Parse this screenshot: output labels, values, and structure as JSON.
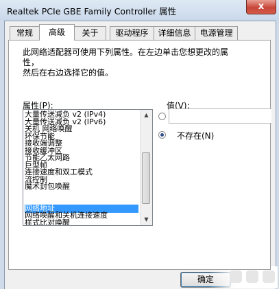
{
  "window": {
    "title": "Realtek PCIe GBE Family Controller 属性",
    "close_label": "x"
  },
  "tabs": [
    {
      "label": "常规",
      "active": false
    },
    {
      "label": "高级",
      "active": true
    },
    {
      "label": "关于",
      "active": false
    },
    {
      "label": "驱动程序",
      "active": false
    },
    {
      "label": "详细信息",
      "active": false
    },
    {
      "label": "电源管理",
      "active": false
    }
  ],
  "advanced": {
    "description_line1": "此网络适配器可使用下列属性。在左边单击您想更改的属性，",
    "description_line2": "然后在右边选择它的值。",
    "property_label": "属性(P):",
    "value_label": "值(V):",
    "value_input": "",
    "not_present_label": "不存在(N)",
    "selected_index": 13,
    "properties": [
      "大量传送减负 v2 (IPv4)",
      "大量传送减负 v2 (IPv6)",
      "关机 网络唤醒",
      "环保节能",
      "接收端调整",
      "接收缓冲区",
      "节能乙太网路",
      "巨型帧",
      "连接速度和双工模式",
      "流控制",
      "魔术封包唤醒",
      "",
      "",
      "网络地址",
      "网络唤醒和关机连接速度",
      "样式比对唤醒"
    ]
  },
  "buttons": {
    "ok": "确定"
  },
  "colors": {
    "selection": "#3399ff",
    "frame": "#cfdbe9"
  }
}
